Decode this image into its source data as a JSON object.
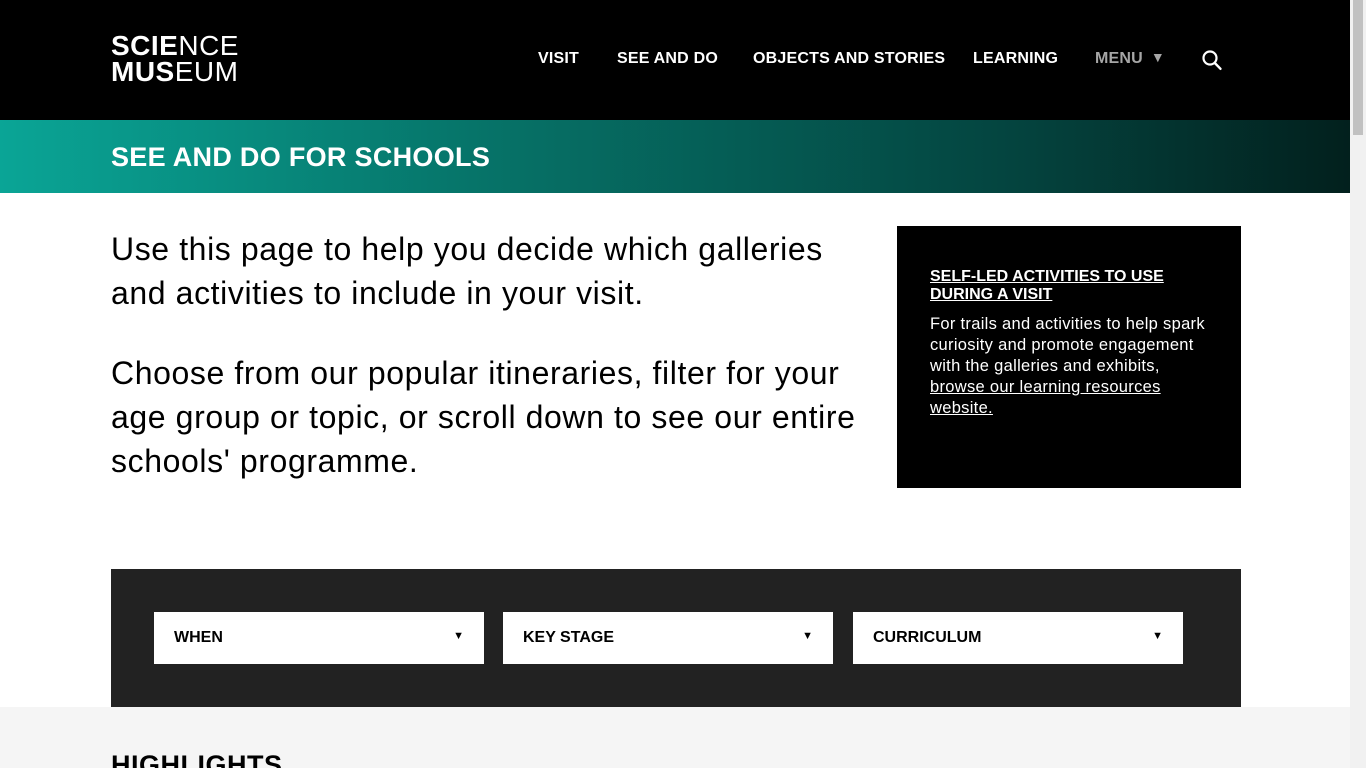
{
  "header": {
    "logo": {
      "line1_bold": "SCIE",
      "line1_thin": "NCE",
      "line2_bold": "MUS",
      "line2_thin": "EUM"
    },
    "nav": {
      "visit": "VISIT",
      "see_and_do": "SEE AND DO",
      "objects_and_stories": "OBJECTS AND STORIES",
      "learning": "LEARNING",
      "menu": "MENU",
      "menu_caret": "▼"
    },
    "search_icon": "search-icon"
  },
  "banner": {
    "title": "SEE AND DO FOR SCHOOLS"
  },
  "intro": {
    "paragraph1": "Use this page to help you decide which galleries and activities to include in your visit.",
    "paragraph2": "Choose from our popular itineraries, filter for your age group or topic, or scroll down to see our entire schools' programme."
  },
  "callout": {
    "title": "SELF-LED ACTIVITIES TO USE DURING A VISIT",
    "text": "For trails and activities to help spark curiosity and promote engagement with the galleries and exhibits,",
    "link": "browse our learning resources website."
  },
  "filters": {
    "when": "WHEN",
    "key_stage": "KEY STAGE",
    "curriculum": "CURRICULUM",
    "caret": "▼"
  },
  "highlights": {
    "title": "HIGHLIGHTS"
  },
  "colors": {
    "header_bg": "#000000",
    "banner_start": "#0aa596",
    "banner_end": "#02201d",
    "filter_bg": "#222222",
    "menu_text": "#a6a6a6"
  }
}
